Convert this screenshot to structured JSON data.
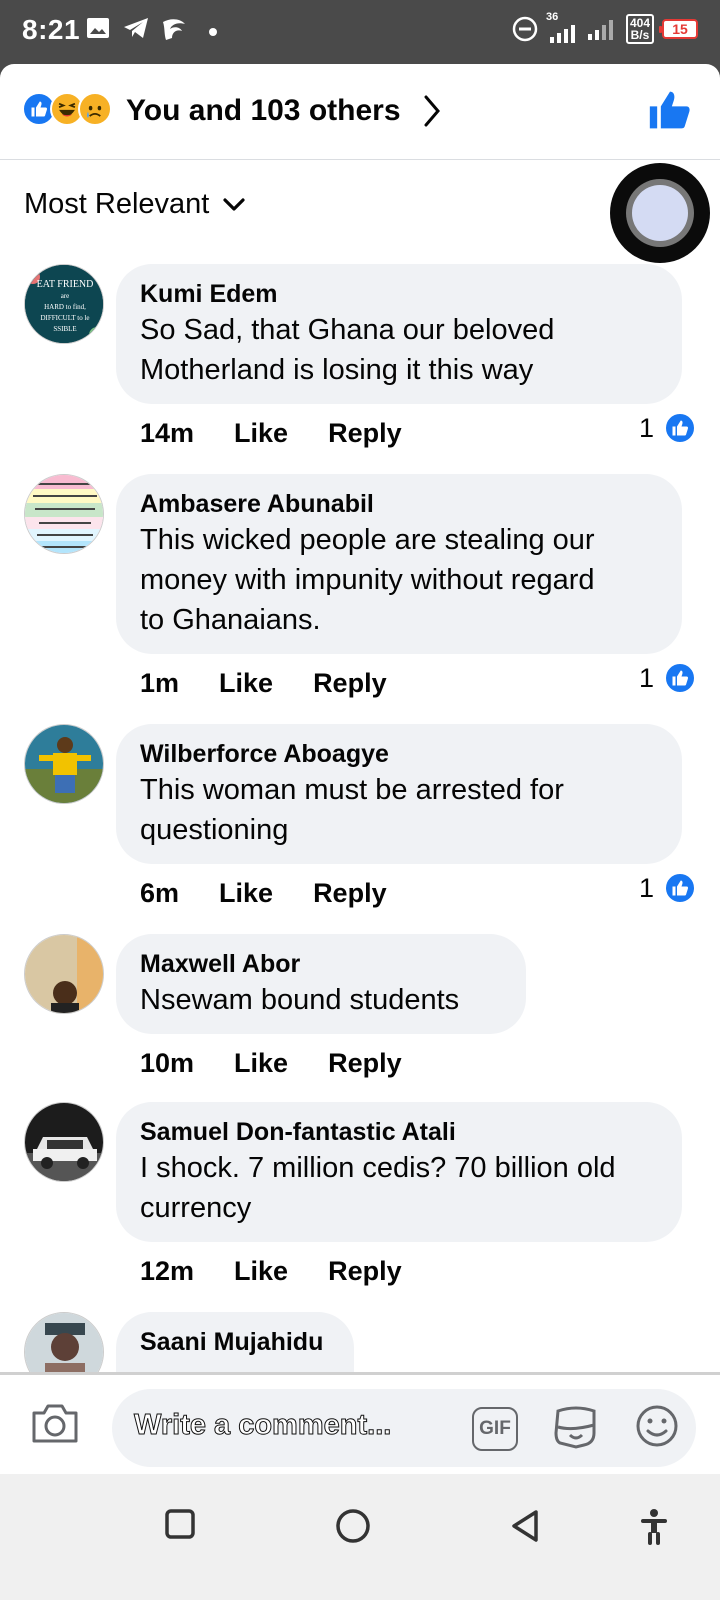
{
  "status_bar": {
    "time": "8:21",
    "network_speed_value": "404",
    "network_speed_unit": "B/s",
    "signal_label": "36",
    "battery": "15"
  },
  "reactions": {
    "summary": "You and 103 others",
    "icons": [
      "like-icon",
      "haha-icon",
      "sad-icon"
    ]
  },
  "sort": {
    "label": "Most Relevant"
  },
  "comments": [
    {
      "name": "Kumi Edem",
      "text_lines": [
        "So Sad, that Ghana our beloved",
        "Motherland is losing it this way"
      ],
      "time": "14m",
      "like_label": "Like",
      "reply_label": "Reply",
      "likes": "1"
    },
    {
      "name": "Ambasere Abunabil",
      "text_lines": [
        "This wicked people are stealing our",
        "money with impunity without regard",
        "to Ghanaians."
      ],
      "time": "1m",
      "like_label": "Like",
      "reply_label": "Reply",
      "likes": "1"
    },
    {
      "name": "Wilberforce Aboagye",
      "text_lines": [
        "This woman must be arrested for",
        "questioning"
      ],
      "time": "6m",
      "like_label": "Like",
      "reply_label": "Reply",
      "likes": "1"
    },
    {
      "name": "Maxwell Abor",
      "text_lines": [
        "Nsewam bound students"
      ],
      "time": "10m",
      "like_label": "Like",
      "reply_label": "Reply",
      "likes": ""
    },
    {
      "name": "Samuel Don-fantastic Atali",
      "text_lines": [
        "I shock. 7 million cedis? 70 billion old",
        "currency"
      ],
      "time": "12m",
      "like_label": "Like",
      "reply_label": "Reply",
      "likes": ""
    },
    {
      "name": "Saani Mujahidu",
      "text_lines": [
        ""
      ],
      "time": "",
      "like_label": "",
      "reply_label": "",
      "likes": ""
    }
  ],
  "avatars": {
    "kumi_lines": [
      "EAT FRIEND",
      "are",
      "HARD to find,",
      "DIFFICULT to le",
      "SSIBLE"
    ]
  },
  "composer": {
    "placeholder": "Write a comment...",
    "gif_label": "GIF"
  },
  "colors": {
    "accent": "#1877f2",
    "bubble_bg": "#f0f2f5",
    "status_bar_bg": "#4a4a4a"
  }
}
